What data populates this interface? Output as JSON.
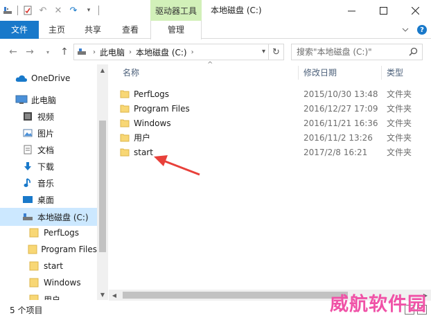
{
  "window": {
    "context_tab": "驱动器工具",
    "title": "本地磁盘 (C:)"
  },
  "ribbon": {
    "tabs": [
      "文件",
      "主页",
      "共享",
      "查看",
      "管理"
    ]
  },
  "address": {
    "crumbs": [
      "此电脑",
      "本地磁盘 (C:)"
    ],
    "search_placeholder": "搜索\"本地磁盘 (C:)\""
  },
  "sidebar": {
    "items": [
      {
        "label": "OneDrive",
        "icon": "cloud-icon"
      },
      {
        "label": "此电脑",
        "icon": "computer-icon"
      },
      {
        "label": "视频",
        "icon": "video-icon"
      },
      {
        "label": "图片",
        "icon": "picture-icon"
      },
      {
        "label": "文档",
        "icon": "document-icon"
      },
      {
        "label": "下载",
        "icon": "download-icon"
      },
      {
        "label": "音乐",
        "icon": "music-icon"
      },
      {
        "label": "桌面",
        "icon": "desktop-icon"
      },
      {
        "label": "本地磁盘 (C:)",
        "icon": "drive-icon"
      },
      {
        "label": "PerfLogs",
        "icon": "folder-icon"
      },
      {
        "label": "Program Files",
        "icon": "folder-icon"
      },
      {
        "label": "start",
        "icon": "folder-icon"
      },
      {
        "label": "Windows",
        "icon": "folder-icon"
      },
      {
        "label": "用户",
        "icon": "folder-icon"
      }
    ]
  },
  "columns": {
    "name": "名称",
    "date": "修改日期",
    "type": "类型"
  },
  "files": [
    {
      "name": "PerfLogs",
      "date": "2015/10/30 13:48",
      "type": "文件夹"
    },
    {
      "name": "Program Files",
      "date": "2016/12/27 17:09",
      "type": "文件夹"
    },
    {
      "name": "Windows",
      "date": "2016/11/21 16:36",
      "type": "文件夹"
    },
    {
      "name": "用户",
      "date": "2016/11/2 13:26",
      "type": "文件夹"
    },
    {
      "name": "start",
      "date": "2017/2/8 16:21",
      "type": "文件夹"
    }
  ],
  "status": {
    "count": "5 个项目"
  },
  "watermark": "威航软件园",
  "colors": {
    "accent": "#1979ca",
    "context_tab": "#d2f0b9",
    "folder": "#f8d775",
    "selected": "#cce8ff",
    "annotation_arrow": "#e8403a",
    "watermark": "#f052a7"
  }
}
